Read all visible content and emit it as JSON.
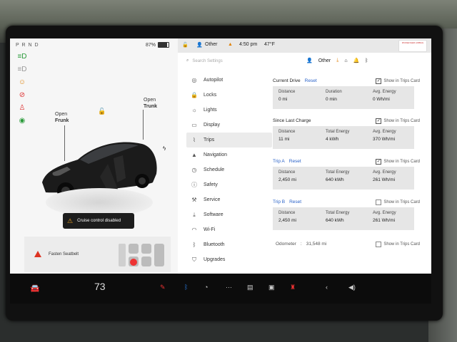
{
  "vehicle": {
    "gear": "P R N D",
    "battery": "87%",
    "battery_level": 0.87,
    "labels": {
      "frunk_open": "Open",
      "frunk_name": "Frunk",
      "trunk_open": "Open",
      "trunk_name": "Trunk"
    },
    "toast": "Cruise control disabled",
    "seatbelt_alert": "Fasten Seatbelt"
  },
  "status": {
    "profile": "Other",
    "time": "4:50 pm",
    "temperature": "47°F",
    "passenger_airbag": "PASSENGER AIRBAG"
  },
  "settings": {
    "search_placeholder": "Search Settings",
    "profile": "Other",
    "menu": [
      {
        "label": "Autopilot",
        "icon": "steering-wheel-icon"
      },
      {
        "label": "Locks",
        "icon": "lock-icon"
      },
      {
        "label": "Lights",
        "icon": "light-icon"
      },
      {
        "label": "Display",
        "icon": "display-icon"
      },
      {
        "label": "Trips",
        "icon": "trips-icon",
        "active": true
      },
      {
        "label": "Navigation",
        "icon": "navigation-icon"
      },
      {
        "label": "Schedule",
        "icon": "schedule-icon"
      },
      {
        "label": "Safety",
        "icon": "safety-icon"
      },
      {
        "label": "Service",
        "icon": "wrench-icon"
      },
      {
        "label": "Software",
        "icon": "download-icon"
      },
      {
        "label": "Wi-Fi",
        "icon": "wifi-icon"
      },
      {
        "label": "Bluetooth",
        "icon": "bluetooth-icon"
      },
      {
        "label": "Upgrades",
        "icon": "bag-icon"
      }
    ]
  },
  "trips": {
    "show_label": "Show in Trips Card",
    "reset_label": "Reset",
    "current": {
      "title": "Current Drive",
      "stats": [
        {
          "k": "Distance",
          "v": "0 mi"
        },
        {
          "k": "Duration",
          "v": "0 min"
        },
        {
          "k": "Avg. Energy",
          "v": "0 Wh/mi"
        }
      ]
    },
    "since_charge": {
      "title": "Since Last Charge",
      "stats": [
        {
          "k": "Distance",
          "v": "11 mi"
        },
        {
          "k": "Total Energy",
          "v": "4 kWh"
        },
        {
          "k": "Avg. Energy",
          "v": "370 Wh/mi"
        }
      ]
    },
    "trip_a": {
      "title": "Trip A",
      "stats": [
        {
          "k": "Distance",
          "v": "2,450 mi"
        },
        {
          "k": "Total Energy",
          "v": "640 kWh"
        },
        {
          "k": "Avg. Energy",
          "v": "261 Wh/mi"
        }
      ]
    },
    "trip_b": {
      "title": "Trip B",
      "stats": [
        {
          "k": "Distance",
          "v": "2,450 mi"
        },
        {
          "k": "Total Energy",
          "v": "640 kWh"
        },
        {
          "k": "Avg. Energy",
          "v": "261 Wh/mi"
        }
      ]
    },
    "odometer_label": "Odometer",
    "odometer_value": "31,548 mi"
  },
  "bottom": {
    "cabin_temp": "73"
  }
}
